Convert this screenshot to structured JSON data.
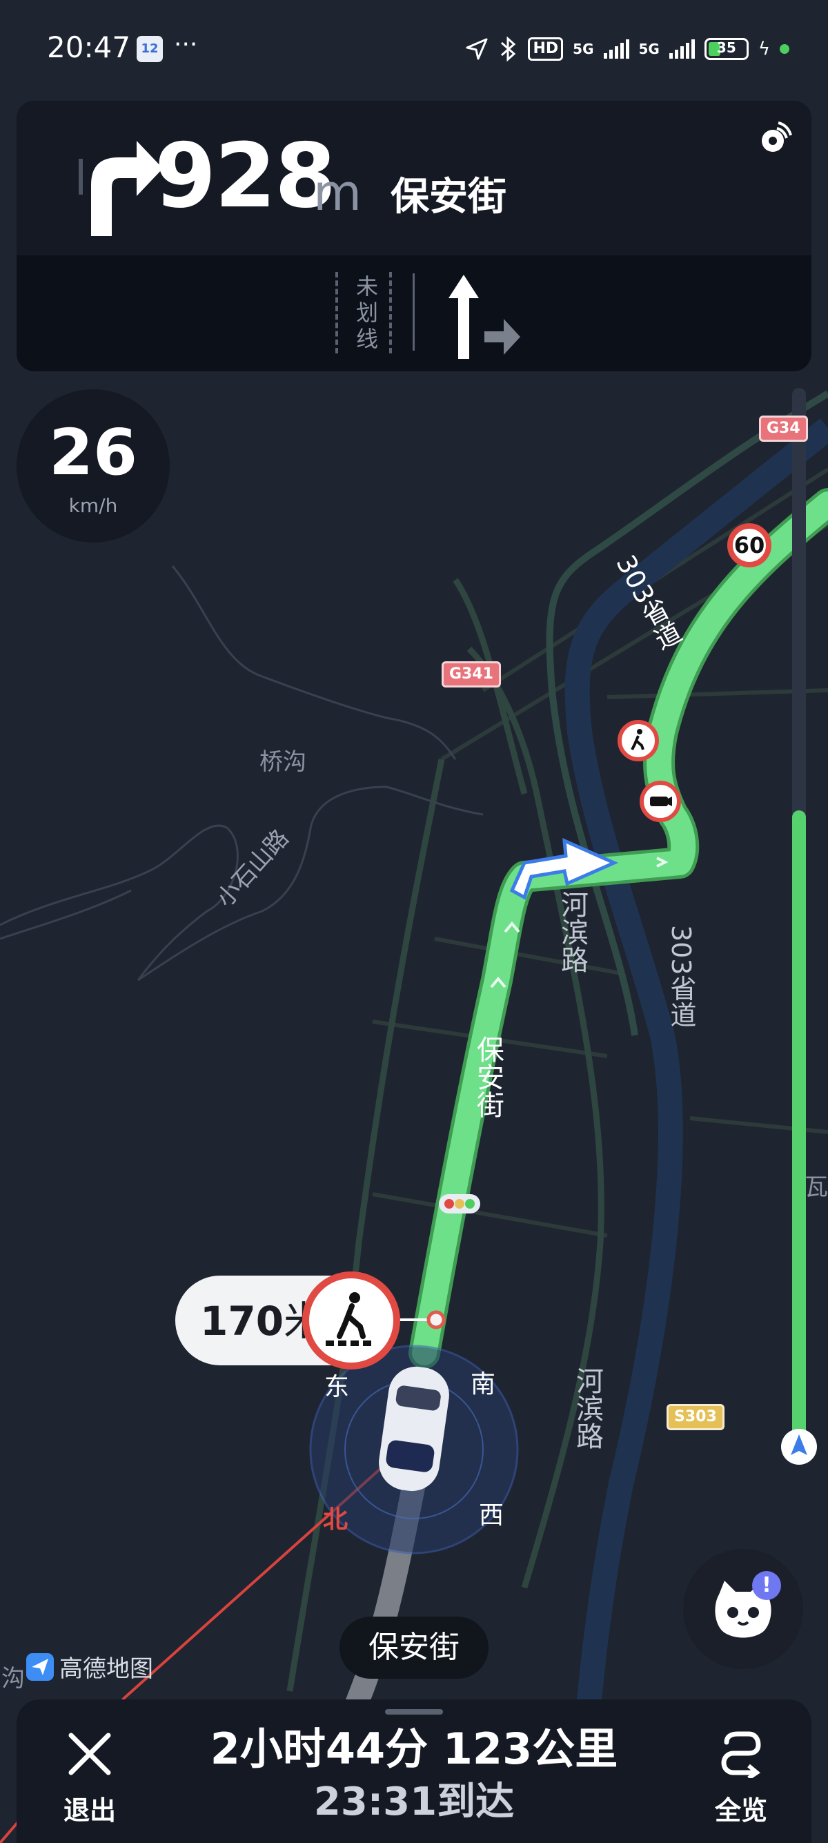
{
  "status_bar": {
    "time": "20:47",
    "calendar_day": "12",
    "more": "···",
    "hd": "HD",
    "network_1": "5G",
    "network_2": "5G",
    "battery": "35",
    "battery_level": 0.35
  },
  "nav": {
    "distance": "928",
    "unit": "m",
    "road": "保安街",
    "turn_icon": "turn-right-arrow",
    "lane_label": [
      "未",
      "划",
      "线"
    ]
  },
  "speed": {
    "value": "26",
    "unit": "km/h"
  },
  "route_progress": 0.6,
  "map": {
    "labels": {
      "qiaogou": "桥沟",
      "xiaoshishan_road": "小石山路",
      "hebin_road": "河滨路",
      "baoan_street": "保安街",
      "provincial_road_1": "303省道",
      "provincial_road_2": "303省道",
      "hebin_road_2": "河滨路",
      "gou": "沟",
      "wa": "瓦"
    },
    "shields": {
      "g341": "G341",
      "g341_top": "G34",
      "s303": "S303"
    },
    "speed_limit": "60"
  },
  "alert": {
    "distance": "170",
    "unit": "米",
    "sign": "pedestrian-crossing-icon"
  },
  "compass": {
    "east": "东",
    "south": "南",
    "north": "北",
    "west": "西"
  },
  "current_road": "保安街",
  "brand": "高德地图",
  "bottom": {
    "trip": "2小时44分  123公里",
    "arrival": "23:31到达",
    "exit_label": "退出",
    "overview_label": "全览"
  },
  "colors": {
    "route": "#56d16e",
    "background": "#1e2430",
    "river": "#1f3350",
    "accent_red": "#e14a43"
  }
}
